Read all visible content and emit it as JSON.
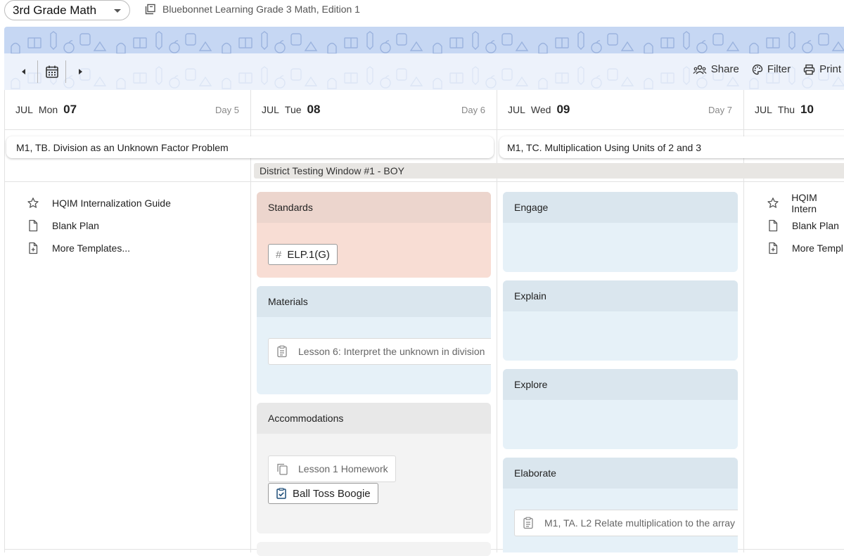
{
  "header": {
    "course": "3rd Grade Math",
    "book": "Bluebonnet Learning Grade 3 Math, Edition 1"
  },
  "toolbar": {
    "share": "Share",
    "filter": "Filter",
    "print": "Print"
  },
  "days": [
    {
      "month": "JUL",
      "dow": "Mon",
      "num": "07",
      "day": "Day 5"
    },
    {
      "month": "JUL",
      "dow": "Tue",
      "num": "08",
      "day": "Day 6"
    },
    {
      "month": "JUL",
      "dow": "Wed",
      "num": "09",
      "day": "Day 7"
    },
    {
      "month": "JUL",
      "dow": "Thu",
      "num": "10",
      "day": ""
    }
  ],
  "topics": [
    "M1, TB. Division as an Unknown Factor Problem",
    "M1, TC. Multiplication Using Units of 2 and 3"
  ],
  "event": "District Testing Window #1 - BOY",
  "templates": {
    "hqim": "HQIM Internalization Guide",
    "blank": "Blank Plan",
    "more": "More Templates...",
    "hqim_cut": "HQIM Intern",
    "more_cut": "More Templ"
  },
  "tue": {
    "standards": {
      "title": "Standards",
      "chip": "ELP.1(G)"
    },
    "materials": {
      "title": "Materials",
      "item": "Lesson 6: Interpret the unknown in division"
    },
    "accommodations": {
      "title": "Accommodations",
      "item1": "Lesson 1 Homework",
      "item2": "Ball Toss Boogie"
    }
  },
  "wed": {
    "engage": "Engage",
    "explain": "Explain",
    "explore": "Explore",
    "elaborate": "Elaborate",
    "elaborate_item": "M1, TA. L2 Relate multiplication to the array"
  },
  "colors": {
    "banner": "#c6d7f3",
    "standards_header": "#ecd5cd",
    "standards_body": "#f8ddd4",
    "blue_header": "#dae6ee",
    "blue_body": "#e6f1f8",
    "gray_header": "#e8e8e8",
    "gray_body": "#f3f3f3"
  }
}
